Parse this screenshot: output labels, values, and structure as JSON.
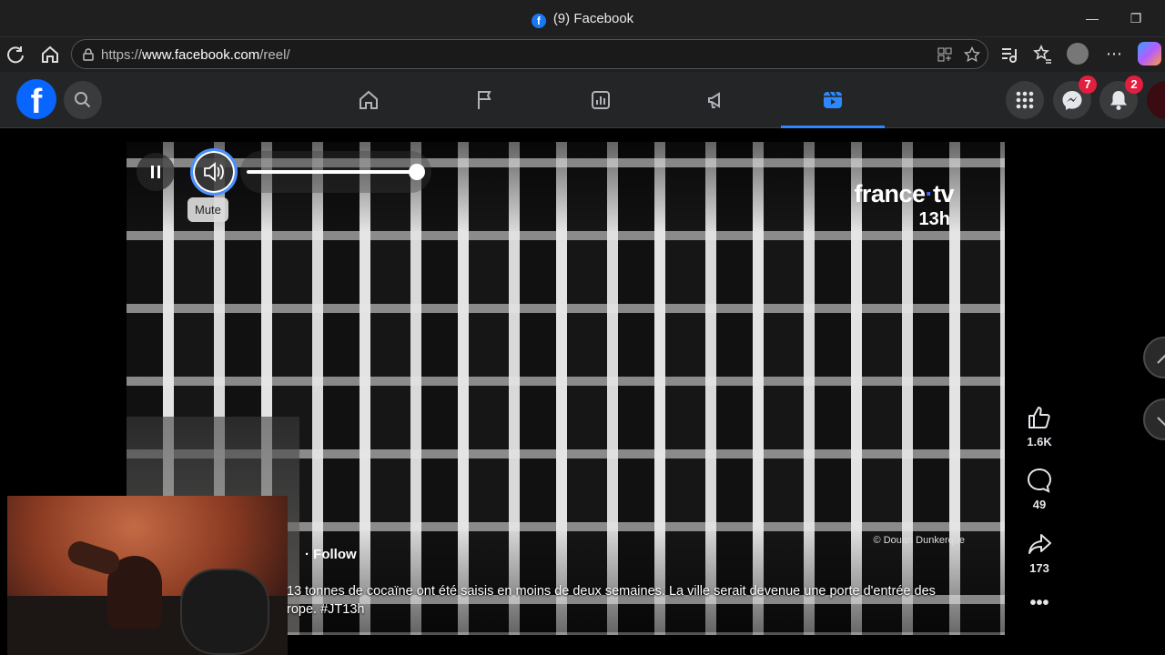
{
  "browser": {
    "tab_title": "(9) Facebook",
    "url_prefix": "https://",
    "url_domain": "www.facebook.com",
    "url_path": "/reel/"
  },
  "nav": {
    "logo": "f",
    "messenger_badge": "7",
    "notifications_badge": "2",
    "active_tab": "reels"
  },
  "reel": {
    "overlay_brand": "france",
    "overlay_brand_suffix": "tv",
    "overlay_program": "13h",
    "photo_credit": "© Douan      Dunkerque",
    "mute_tooltip": "Mute",
    "follow_label": "· Follow",
    "caption_line1": "13 tonnes de cocaïne ont été saisis en moins de deux semaines. La ville serait devenue une porte d'entrée des",
    "caption_line2": "rope. #JT13h",
    "volume_level": 1.0
  },
  "actions": {
    "likes": "1.6K",
    "comments": "49",
    "shares": "173"
  },
  "colors": {
    "accent": "#2d88ff",
    "badge": "#e41e3f",
    "fb_blue": "#0866ff"
  }
}
